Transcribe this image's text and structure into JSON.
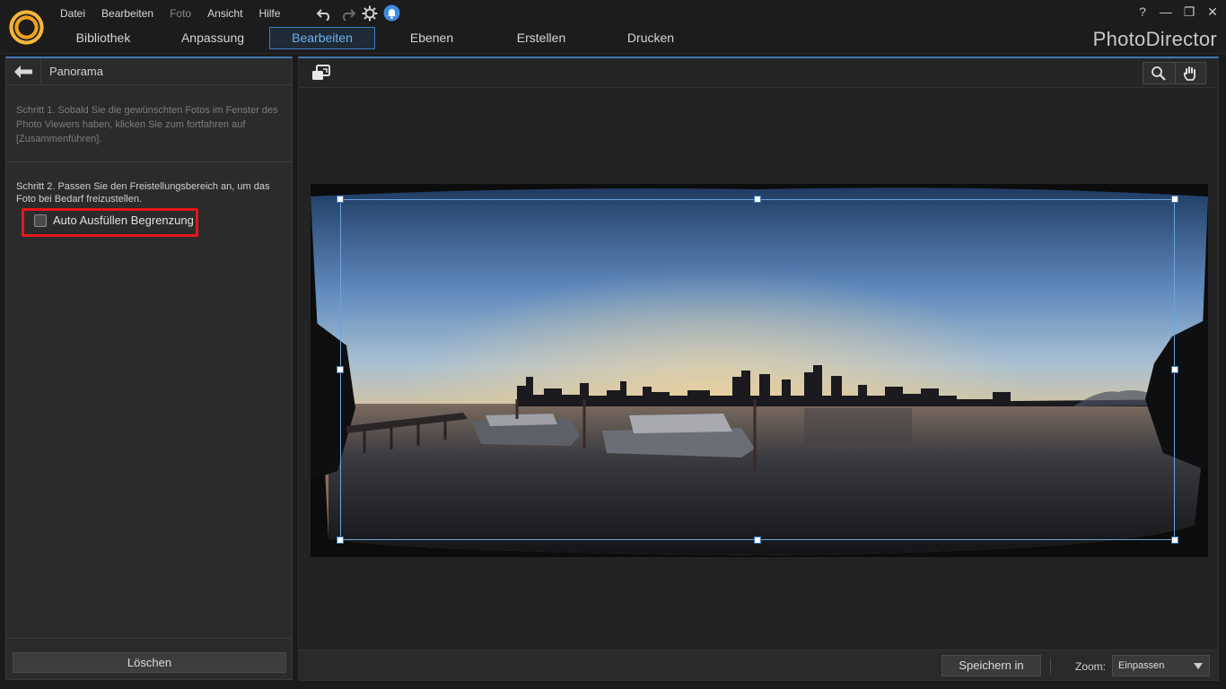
{
  "menu": {
    "items": [
      {
        "label": "Datei",
        "enabled": true
      },
      {
        "label": "Bearbeiten",
        "enabled": true
      },
      {
        "label": "Foto",
        "enabled": false
      },
      {
        "label": "Ansicht",
        "enabled": true
      },
      {
        "label": "Hilfe",
        "enabled": true
      }
    ]
  },
  "window": {
    "help": "?",
    "minimize": "—",
    "maximize": "❐",
    "close": "✕"
  },
  "brand": {
    "name": "PhotoDirector"
  },
  "tabs": [
    {
      "label": "Bibliothek",
      "active": false
    },
    {
      "label": "Anpassung",
      "active": false
    },
    {
      "label": "Bearbeiten",
      "active": true
    },
    {
      "label": "Ebenen",
      "active": false
    },
    {
      "label": "Erstellen",
      "active": false
    },
    {
      "label": "Drucken",
      "active": false
    }
  ],
  "panel": {
    "title": "Panorama",
    "step1": "Schritt 1. Sobald Sie die gewünschten Fotos im Fenster des Photo Viewers haben, klicken Sie zum fortfahren auf [Zusammenführen].",
    "step2": "Schritt 2. Passen Sie den Freistellungsbereich an, um das Foto bei Bedarf freizustellen.",
    "checkbox_label": "Auto Ausfüllen Begrenzung",
    "checkbox_checked": false,
    "delete_label": "Löschen"
  },
  "viewer": {
    "save_label": "Speichern in",
    "zoom_label": "Zoom:",
    "zoom_value": "Einpassen"
  },
  "colors": {
    "accent": "#3d7ec5",
    "highlight": "#e5161a",
    "active_tab_text": "#6db0ee"
  }
}
